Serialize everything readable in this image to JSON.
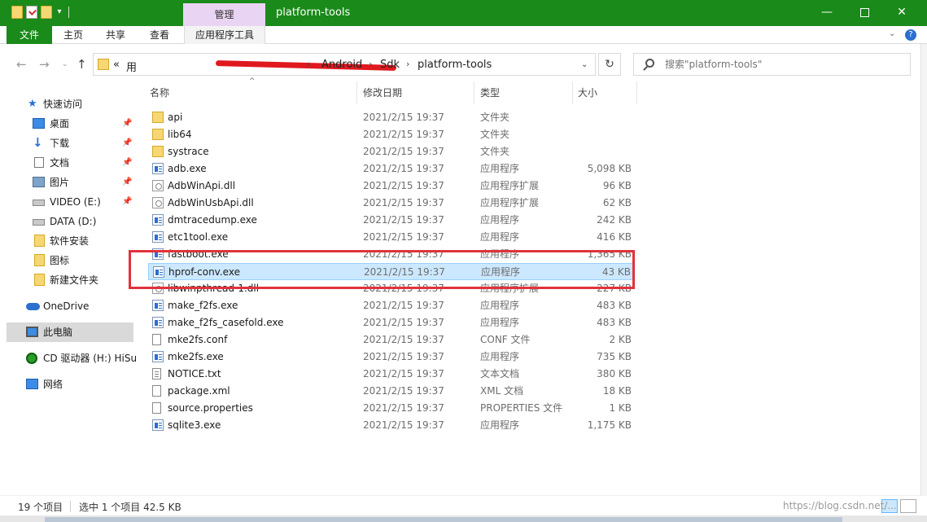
{
  "window": {
    "title": "platform-tools",
    "context_tab": "管理",
    "minimize_symbol": "—",
    "close_symbol": "✕"
  },
  "quick_access_toolbar": {
    "dropdown_symbol": "▾"
  },
  "ribbon": {
    "tabs": [
      {
        "label": "文件",
        "active": true
      },
      {
        "label": "主页"
      },
      {
        "label": "共享"
      },
      {
        "label": "查看"
      },
      {
        "label": "应用程序工具"
      }
    ],
    "collapse_symbol": "⌄",
    "help_symbol": "?"
  },
  "navigation": {
    "back_symbol": "←",
    "forward_symbol": "→",
    "recent_symbol": "⌄",
    "up_symbol": "↑",
    "refresh_symbol": "↻",
    "address_prefix": "«",
    "address_partial": "用",
    "breadcrumb": [
      "Android",
      "Sdk",
      "platform-tools"
    ],
    "breadcrumb_sep": "›",
    "search_placeholder": "搜索\"platform-tools\""
  },
  "sidebar": {
    "pin_symbol": "📌",
    "items": [
      {
        "label": "快速访问",
        "icon": "star-icon"
      },
      {
        "label": "桌面",
        "icon": "desktop-icon",
        "pinned": true
      },
      {
        "label": "下载",
        "icon": "download-icon",
        "pinned": true
      },
      {
        "label": "文档",
        "icon": "document-icon",
        "pinned": true
      },
      {
        "label": "图片",
        "icon": "pictures-icon",
        "pinned": true
      },
      {
        "label": "VIDEO (E:)",
        "icon": "drive-icon",
        "pinned": true
      },
      {
        "label": "DATA (D:)",
        "icon": "drive-icon"
      },
      {
        "label": "软件安装",
        "icon": "folder-icon"
      },
      {
        "label": "图标",
        "icon": "folder-icon"
      },
      {
        "label": "新建文件夹",
        "icon": "folder-icon"
      },
      {
        "label": "OneDrive",
        "icon": "onedrive-icon"
      },
      {
        "label": "此电脑",
        "icon": "this-pc-icon",
        "selected": true
      },
      {
        "label": "CD 驱动器 (H:) HiSu",
        "icon": "cd-drive-icon"
      },
      {
        "label": "网络",
        "icon": "network-icon"
      }
    ]
  },
  "file_list": {
    "sort_symbol": "^",
    "columns": [
      "名称",
      "修改日期",
      "类型",
      "大小"
    ],
    "rows": [
      {
        "name": "api",
        "date": "2021/2/15 19:37",
        "type": "文件夹",
        "size": "",
        "icon": "folder"
      },
      {
        "name": "lib64",
        "date": "2021/2/15 19:37",
        "type": "文件夹",
        "size": "",
        "icon": "folder"
      },
      {
        "name": "systrace",
        "date": "2021/2/15 19:37",
        "type": "文件夹",
        "size": "",
        "icon": "folder"
      },
      {
        "name": "adb.exe",
        "date": "2021/2/15 19:37",
        "type": "应用程序",
        "size": "5,098 KB",
        "icon": "exe"
      },
      {
        "name": "AdbWinApi.dll",
        "date": "2021/2/15 19:37",
        "type": "应用程序扩展",
        "size": "96 KB",
        "icon": "dll"
      },
      {
        "name": "AdbWinUsbApi.dll",
        "date": "2021/2/15 19:37",
        "type": "应用程序扩展",
        "size": "62 KB",
        "icon": "dll"
      },
      {
        "name": "dmtracedump.exe",
        "date": "2021/2/15 19:37",
        "type": "应用程序",
        "size": "242 KB",
        "icon": "exe"
      },
      {
        "name": "etc1tool.exe",
        "date": "2021/2/15 19:37",
        "type": "应用程序",
        "size": "416 KB",
        "icon": "exe"
      },
      {
        "name": "fastboot.exe",
        "date": "2021/2/15 19:37",
        "type": "应用程序",
        "size": "1,365 KB",
        "icon": "exe"
      },
      {
        "name": "hprof-conv.exe",
        "date": "2021/2/15 19:37",
        "type": "应用程序",
        "size": "43 KB",
        "icon": "exe",
        "selected": true
      },
      {
        "name": "libwinpthread-1.dll",
        "date": "2021/2/15 19:37",
        "type": "应用程序扩展",
        "size": "227 KB",
        "icon": "dll"
      },
      {
        "name": "make_f2fs.exe",
        "date": "2021/2/15 19:37",
        "type": "应用程序",
        "size": "483 KB",
        "icon": "exe"
      },
      {
        "name": "make_f2fs_casefold.exe",
        "date": "2021/2/15 19:37",
        "type": "应用程序",
        "size": "483 KB",
        "icon": "exe"
      },
      {
        "name": "mke2fs.conf",
        "date": "2021/2/15 19:37",
        "type": "CONF 文件",
        "size": "2 KB",
        "icon": "file"
      },
      {
        "name": "mke2fs.exe",
        "date": "2021/2/15 19:37",
        "type": "应用程序",
        "size": "735 KB",
        "icon": "exe"
      },
      {
        "name": "NOTICE.txt",
        "date": "2021/2/15 19:37",
        "type": "文本文档",
        "size": "380 KB",
        "icon": "txt"
      },
      {
        "name": "package.xml",
        "date": "2021/2/15 19:37",
        "type": "XML 文档",
        "size": "18 KB",
        "icon": "file"
      },
      {
        "name": "source.properties",
        "date": "2021/2/15 19:37",
        "type": "PROPERTIES 文件",
        "size": "1 KB",
        "icon": "file"
      },
      {
        "name": "sqlite3.exe",
        "date": "2021/2/15 19:37",
        "type": "应用程序",
        "size": "1,175 KB",
        "icon": "exe"
      }
    ]
  },
  "status_bar": {
    "item_count": "19 个项目",
    "selection": "选中 1 个项目  42.5 KB",
    "watermark": "https://blog.csdn.net/..."
  },
  "colors": {
    "titlebar": "#1a8a1a",
    "selection_bg": "#cce8ff",
    "highlight_box": "#e0333c"
  }
}
